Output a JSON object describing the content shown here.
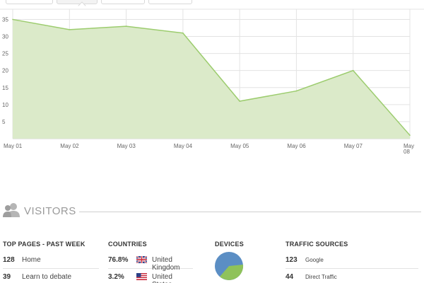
{
  "chart_data": {
    "type": "area",
    "categories": [
      "May 01",
      "May 02",
      "May 03",
      "May 04",
      "May 05",
      "May 06",
      "May 07",
      "May\n08"
    ],
    "values": [
      35,
      32,
      33,
      31,
      11,
      14,
      20,
      1
    ],
    "yticks": [
      5,
      10,
      15,
      20,
      25,
      30,
      35
    ],
    "ylim": [
      0,
      38
    ],
    "grid": true,
    "colors": {
      "fill": "#dbeac9",
      "line": "#9ccc6e",
      "grid": "#e3e3e3"
    }
  },
  "visitors": {
    "title": "VISITORS",
    "icon": "users-icon"
  },
  "top_pages": {
    "title": "TOP PAGES - PAST WEEK",
    "rows": [
      {
        "count": "128",
        "label": "Home"
      },
      {
        "count": "39",
        "label": "Learn to debate"
      }
    ]
  },
  "countries": {
    "title": "COUNTRIES",
    "rows": [
      {
        "percent": "76.8%",
        "flag": "uk-flag-icon",
        "label": "United Kingdom"
      },
      {
        "percent": "3.2%",
        "flag": "us-flag-icon",
        "label": "United States"
      }
    ]
  },
  "devices": {
    "title": "DEVICES",
    "colors": {
      "primary": "#5b8ec4",
      "secondary": "#8fc25a"
    }
  },
  "traffic_sources": {
    "title": "TRAFFIC SOURCES",
    "rows": [
      {
        "count": "123",
        "label": "Google"
      },
      {
        "count": "44",
        "label": "Direct Traffic"
      }
    ]
  }
}
